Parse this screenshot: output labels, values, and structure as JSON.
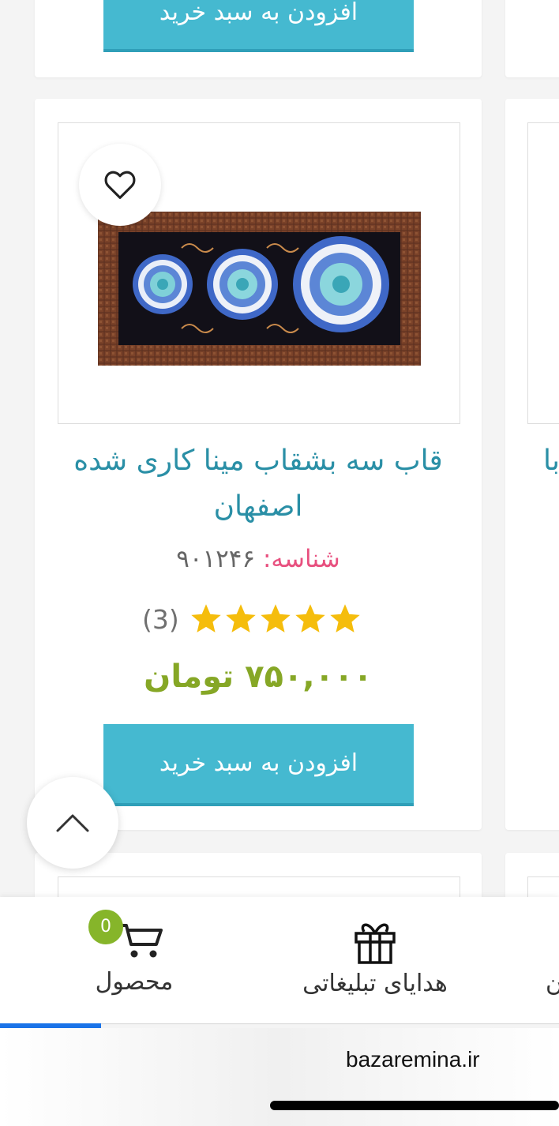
{
  "previous_card": {
    "add_to_cart_label": "افزودن به سبد خرید"
  },
  "product": {
    "title": "قاب سه بشقاب مینا کاری شده اصفهان",
    "sku_label": "شناسه:",
    "sku_value": "۹۰۱۲۴۶",
    "rating": 5,
    "review_count": "(3)",
    "price": "۷۵۰,۰۰۰ تومان",
    "add_to_cart_label": "افزودن به سبد خرید"
  },
  "neighbor_card": {
    "title_fragment": "با"
  },
  "bottom_nav": {
    "cart": {
      "label": "محصول",
      "badge": "0"
    },
    "gifts": {
      "label": "هدایای تبلیغاتی"
    },
    "partial": {
      "label": "ن"
    }
  },
  "browser": {
    "url": "bazaremina.ir"
  },
  "colors": {
    "accent_button": "#45b9d0",
    "title_text": "#2a8fa6",
    "sku_label": "#e8507f",
    "price": "#86a726",
    "star": "#f5bd0c",
    "badge": "#86b52a",
    "tab_indicator": "#1a73e8"
  },
  "icons": {
    "wishlist": "heart-outline-icon",
    "scroll_top": "chevron-up-icon",
    "cart": "cart-icon",
    "gifts": "gift-icon"
  }
}
